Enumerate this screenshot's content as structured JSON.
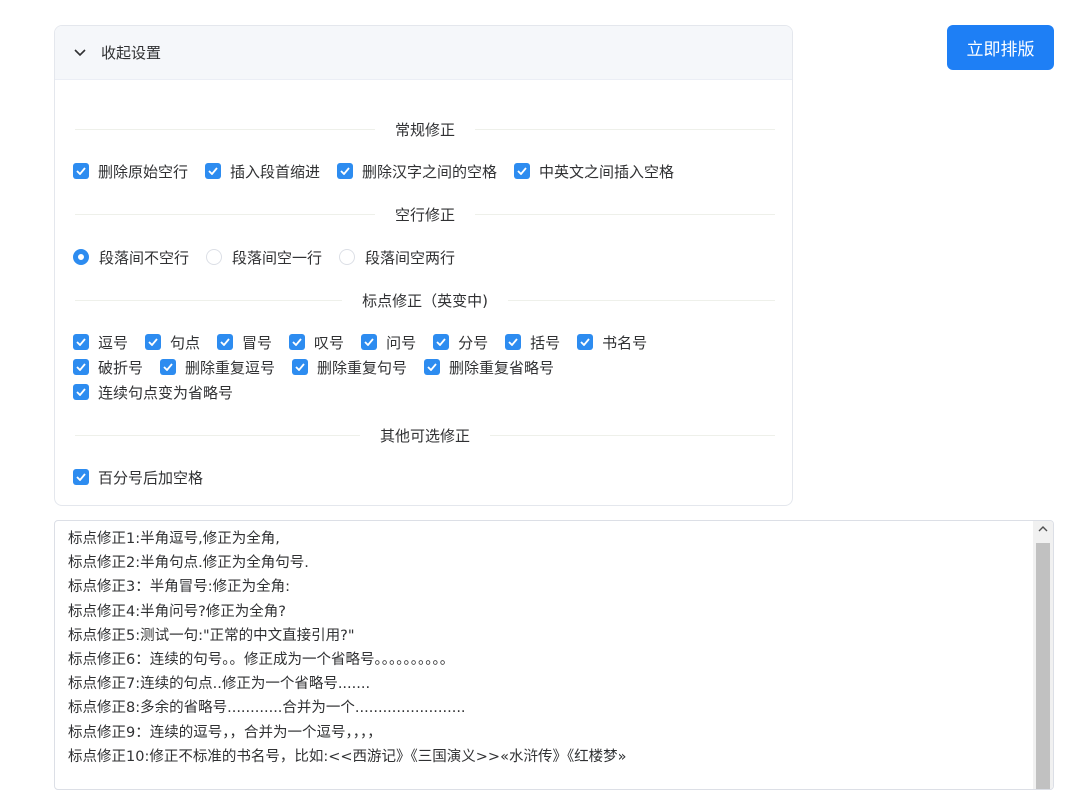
{
  "settings": {
    "collapse_label": "收起设置",
    "sections": {
      "regular": {
        "title": "常规修正",
        "options": [
          {
            "label": "删除原始空行",
            "checked": true
          },
          {
            "label": "插入段首缩进",
            "checked": true
          },
          {
            "label": "删除汉字之间的空格",
            "checked": true
          },
          {
            "label": "中英文之间插入空格",
            "checked": true
          }
        ]
      },
      "blank_lines": {
        "title": "空行修正",
        "options": [
          {
            "label": "段落间不空行",
            "selected": true
          },
          {
            "label": "段落间空一行",
            "selected": false
          },
          {
            "label": "段落间空两行",
            "selected": false
          }
        ]
      },
      "punctuation": {
        "title": "标点修正（英变中)",
        "options": [
          {
            "label": "逗号",
            "checked": true
          },
          {
            "label": "句点",
            "checked": true
          },
          {
            "label": "冒号",
            "checked": true
          },
          {
            "label": "叹号",
            "checked": true
          },
          {
            "label": "问号",
            "checked": true
          },
          {
            "label": "分号",
            "checked": true
          },
          {
            "label": "括号",
            "checked": true
          },
          {
            "label": "书名号",
            "checked": true
          },
          {
            "label": "破折号",
            "checked": true
          },
          {
            "label": "删除重复逗号",
            "checked": true
          },
          {
            "label": "删除重复句号",
            "checked": true
          },
          {
            "label": "删除重复省略号",
            "checked": true
          },
          {
            "label": "连续句点变为省略号",
            "checked": true
          }
        ]
      },
      "other": {
        "title": "其他可选修正",
        "options": [
          {
            "label": "百分号后加空格",
            "checked": true
          }
        ]
      }
    }
  },
  "action": {
    "format_button": "立即排版"
  },
  "editor": {
    "lines": [
      "标点修正1:半角逗号,修正为全角,",
      "标点修正2:半角句点.修正为全角句号.",
      "标点修正3：半角冒号:修正为全角:",
      "标点修正4:半角问号?修正为全角?",
      "标点修正5:测试一句:\"正常的中文直接引用?\"",
      "标点修正6：连续的句号。。修正成为一个省略号。。。。。。。。。。",
      "标点修正7:连续的句点..修正为一个省略号.......",
      "标点修正8:多余的省略号............合并为一个........................",
      "标点修正9：连续的逗号，，合并为一个逗号，，，，",
      "标点修正10:修正不标准的书名号，比如:<<西游记》《三国演义>>«水浒传》《红楼梦»"
    ]
  },
  "colors": {
    "accent": "#1e7ff5",
    "checkbox": "#2d8cf0"
  },
  "icons": {
    "collapse": "chevron-down-icon",
    "check": "check-icon",
    "scroll_up": "chevron-up-icon"
  }
}
